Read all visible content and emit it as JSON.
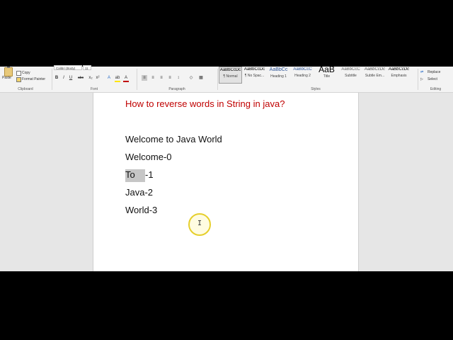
{
  "ribbon": {
    "clipboard": {
      "paste": "Paste",
      "copy": "Copy",
      "format_painter": "Format Painter",
      "label": "Clipboard"
    },
    "font": {
      "font_name": "Calibri (Body)",
      "font_size": "11",
      "label": "Font",
      "bold": "B",
      "italic": "I",
      "underline": "U",
      "strikethrough": "abc",
      "subscript": "x₂",
      "superscript": "x²"
    },
    "paragraph": {
      "label": "Paragraph"
    },
    "styles": {
      "label": "Styles",
      "items": [
        {
          "preview": "AaBbCcDc",
          "name": "¶ Normal"
        },
        {
          "preview": "AaBbCcDc",
          "name": "¶ No Spac..."
        },
        {
          "preview": "AaBbCc",
          "name": "Heading 1"
        },
        {
          "preview": "AaBbCcC",
          "name": "Heading 2"
        },
        {
          "preview": "AaB",
          "name": "Title"
        },
        {
          "preview": "AaBbCcC",
          "name": "Subtitle"
        },
        {
          "preview": "AaBbCcDc",
          "name": "Subtle Em..."
        },
        {
          "preview": "AaBbCcDc",
          "name": "Emphasis"
        }
      ]
    },
    "editing": {
      "replace": "Replace",
      "select": "Select",
      "label": "Editing"
    }
  },
  "document": {
    "title": "How to reverse words in String in java?",
    "line1": "Welcome to Java World",
    "line2": "Welcome-0",
    "line3_word": "To",
    "line3_rest": "-1",
    "line4": "Java-2",
    "line5": "World-3"
  },
  "colors": {
    "title": "#c00000",
    "highlight": "#c6c6c6",
    "cursor_ring": "#e6cf2c"
  },
  "icons": [
    "paste-icon",
    "copy-icon",
    "format-painter-icon",
    "replace-icon",
    "select-icon",
    "ibeam-cursor-icon"
  ]
}
